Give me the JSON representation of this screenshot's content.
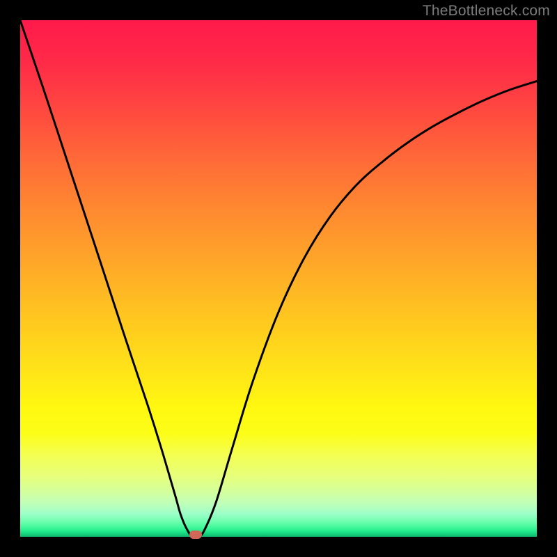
{
  "watermark": "TheBottleneck.com",
  "marker_color": "#d06858",
  "chart_data": {
    "type": "line",
    "title": "",
    "xlabel": "",
    "ylabel": "",
    "xlim": [
      0,
      1
    ],
    "ylim": [
      0,
      1
    ],
    "series": [
      {
        "name": "bottleneck-curve",
        "x": [
          0.0,
          0.05,
          0.1,
          0.15,
          0.2,
          0.225,
          0.25,
          0.275,
          0.3,
          0.31,
          0.32,
          0.333,
          0.347,
          0.36,
          0.38,
          0.41,
          0.45,
          0.5,
          0.55,
          0.6,
          0.65,
          0.7,
          0.75,
          0.8,
          0.85,
          0.9,
          0.95,
          1.0
        ],
        "y": [
          1.0,
          0.852,
          0.7,
          0.548,
          0.395,
          0.32,
          0.245,
          0.165,
          0.08,
          0.045,
          0.02,
          0.0,
          0.0,
          0.02,
          0.07,
          0.17,
          0.3,
          0.435,
          0.54,
          0.62,
          0.68,
          0.725,
          0.763,
          0.795,
          0.822,
          0.846,
          0.866,
          0.882
        ]
      }
    ],
    "marker": {
      "x": 0.34,
      "y": 0.0
    },
    "background_gradient": {
      "top": "#ff1a4a",
      "mid": "#ffe418",
      "bottom": "#0cb46c"
    }
  }
}
